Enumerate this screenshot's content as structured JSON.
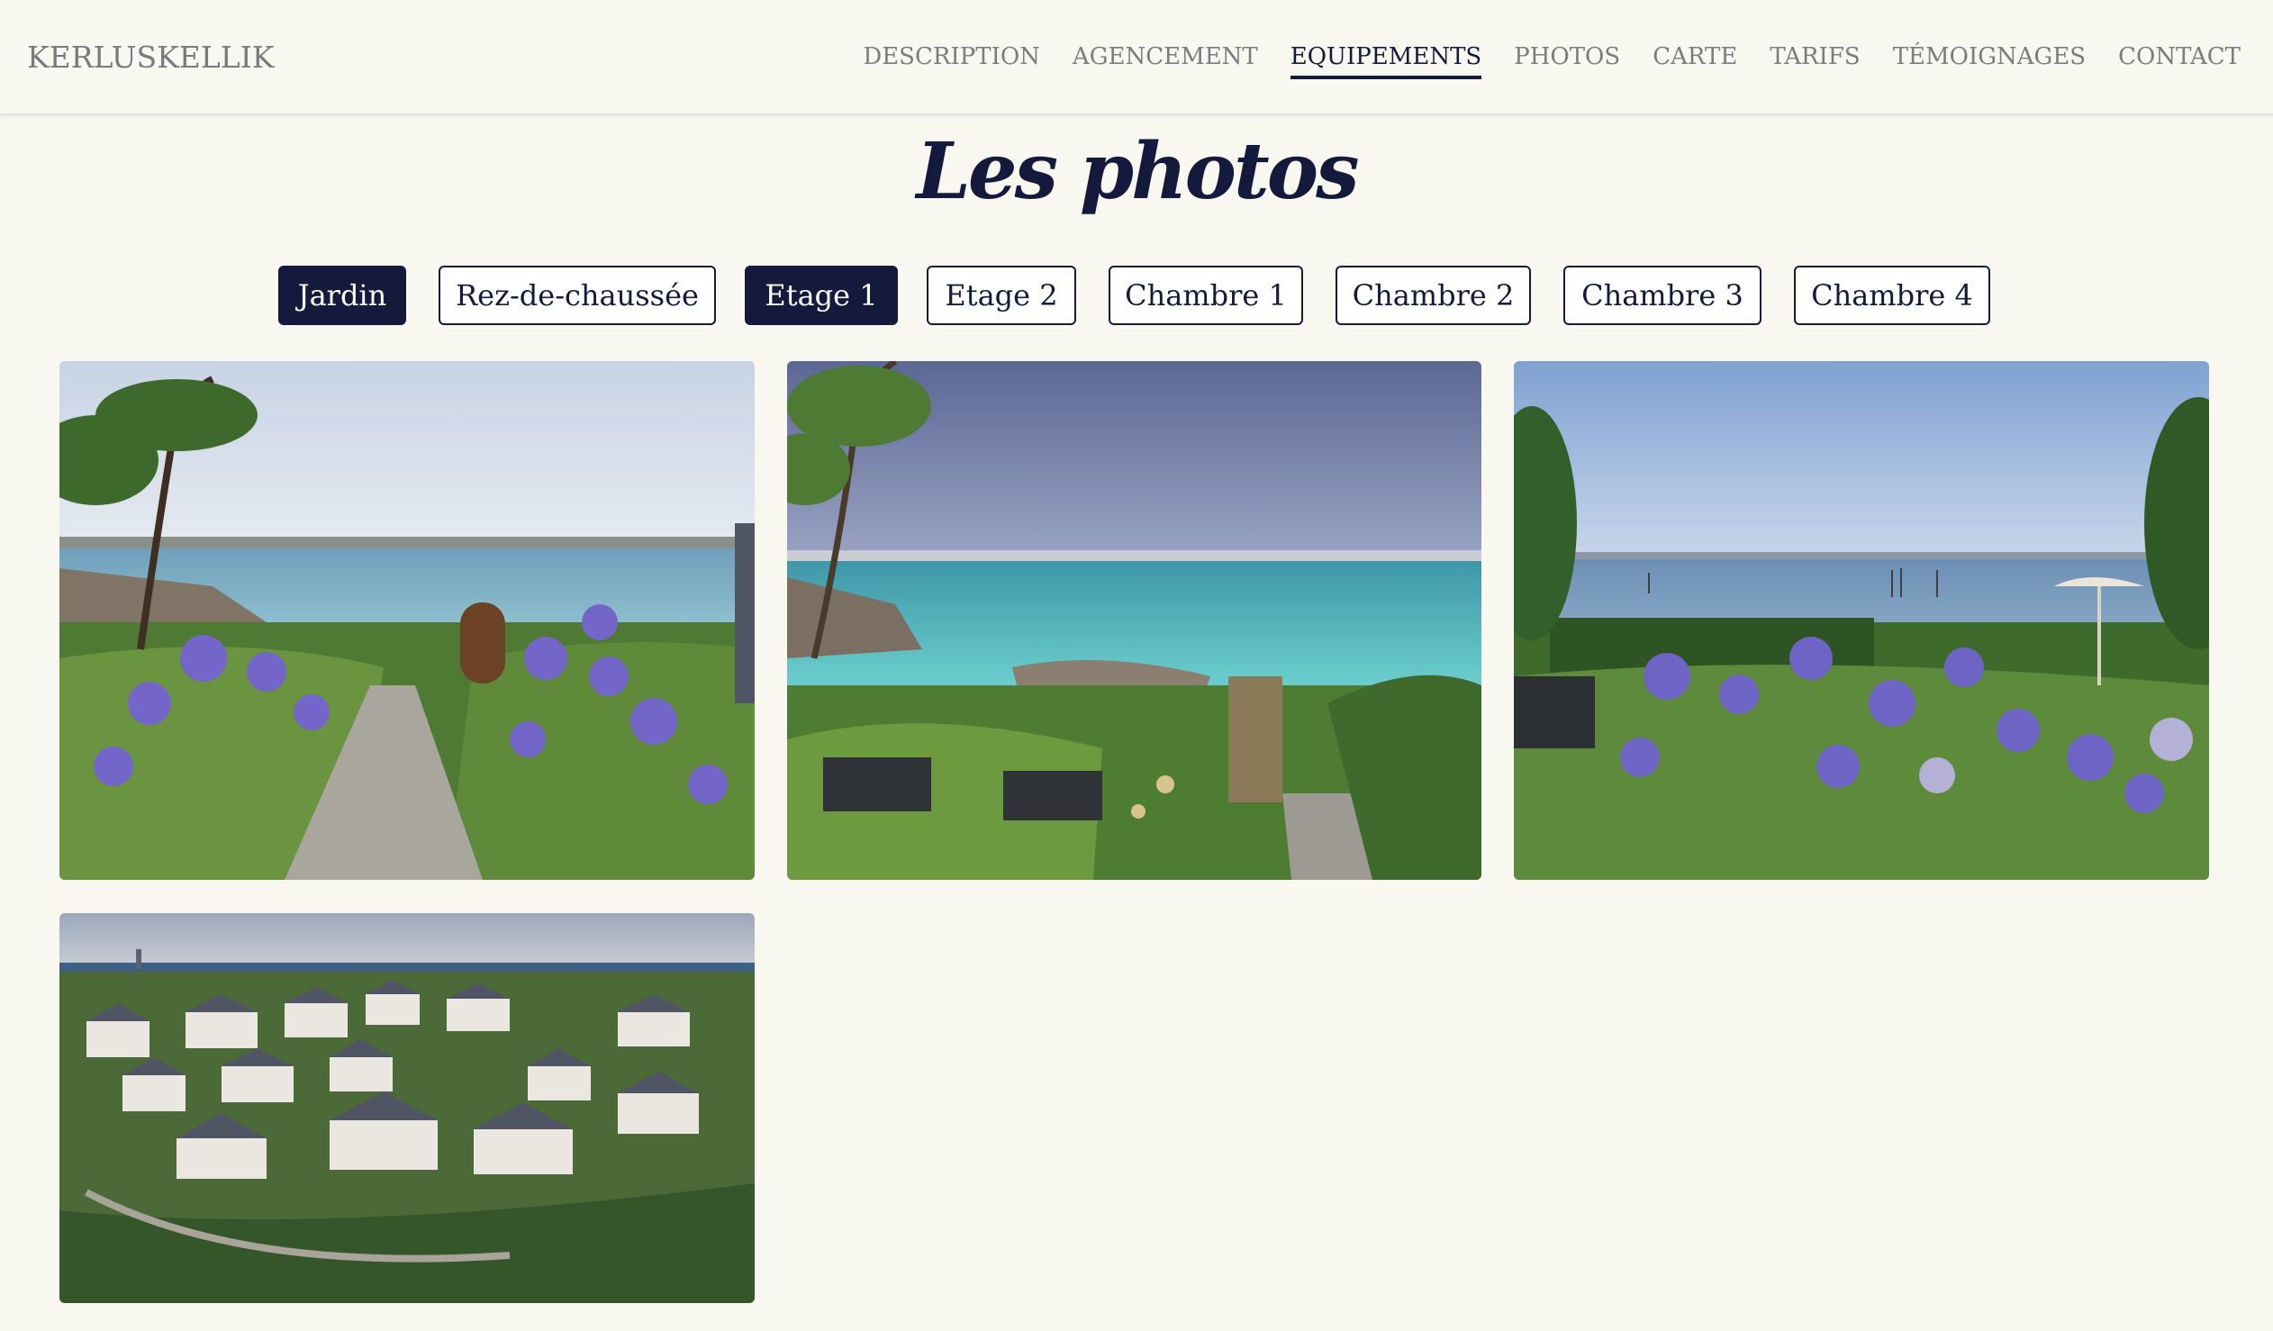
{
  "header": {
    "brand": "KERLUSKELLIK",
    "nav": [
      {
        "label": "DESCRIPTION",
        "active": false
      },
      {
        "label": "AGENCEMENT",
        "active": false
      },
      {
        "label": "EQUIPEMENTS",
        "active": true
      },
      {
        "label": "PHOTOS",
        "active": false
      },
      {
        "label": "CARTE",
        "active": false
      },
      {
        "label": "TARIFS",
        "active": false
      },
      {
        "label": "TÉMOIGNAGES",
        "active": false
      },
      {
        "label": "CONTACT",
        "active": false
      }
    ]
  },
  "section": {
    "title": "Les photos"
  },
  "filters": [
    {
      "label": "Jardin",
      "selected": true
    },
    {
      "label": "Rez-de-chaussée",
      "selected": false
    },
    {
      "label": "Etage 1",
      "selected": true
    },
    {
      "label": "Etage 2",
      "selected": false
    },
    {
      "label": "Chambre 1",
      "selected": false
    },
    {
      "label": "Chambre 2",
      "selected": false
    },
    {
      "label": "Chambre 3",
      "selected": false
    },
    {
      "label": "Chambre 4",
      "selected": false
    }
  ],
  "photos": [
    {
      "subject": "garden-path-agapanthus-sea-view"
    },
    {
      "subject": "garden-turquoise-bay-palm"
    },
    {
      "subject": "garden-agapanthus-boats-umbrella"
    },
    {
      "subject": "aerial-village-houses"
    }
  ],
  "colors": {
    "background": "#f8f7f0",
    "navy": "#141a3c",
    "nav_text": "#7c7c80"
  }
}
